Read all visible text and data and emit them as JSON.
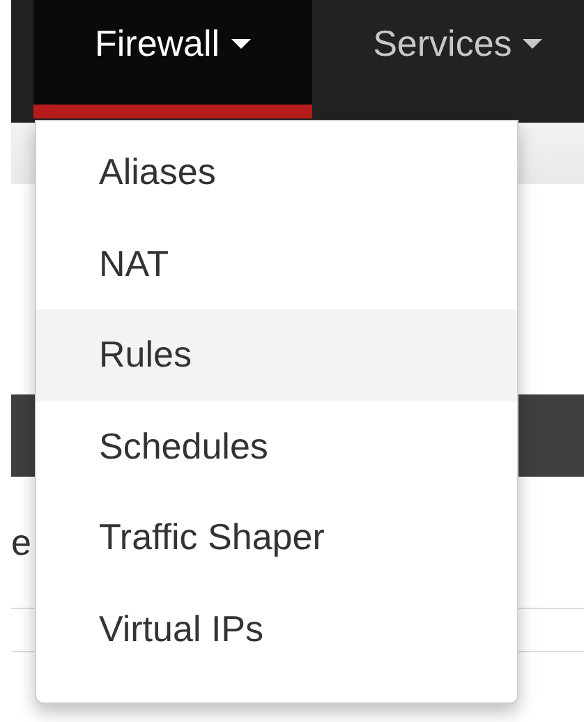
{
  "navbar": {
    "items": [
      {
        "label": "Firewall",
        "selected": true
      },
      {
        "label": "Services",
        "selected": false
      }
    ]
  },
  "background_text": "e",
  "dropdown": {
    "items": [
      {
        "label": "Aliases",
        "selected": false
      },
      {
        "label": "NAT",
        "selected": false
      },
      {
        "label": "Rules",
        "selected": true
      },
      {
        "label": "Schedules",
        "selected": false
      },
      {
        "label": "Traffic Shaper",
        "selected": false
      },
      {
        "label": "Virtual IPs",
        "selected": false
      }
    ]
  }
}
